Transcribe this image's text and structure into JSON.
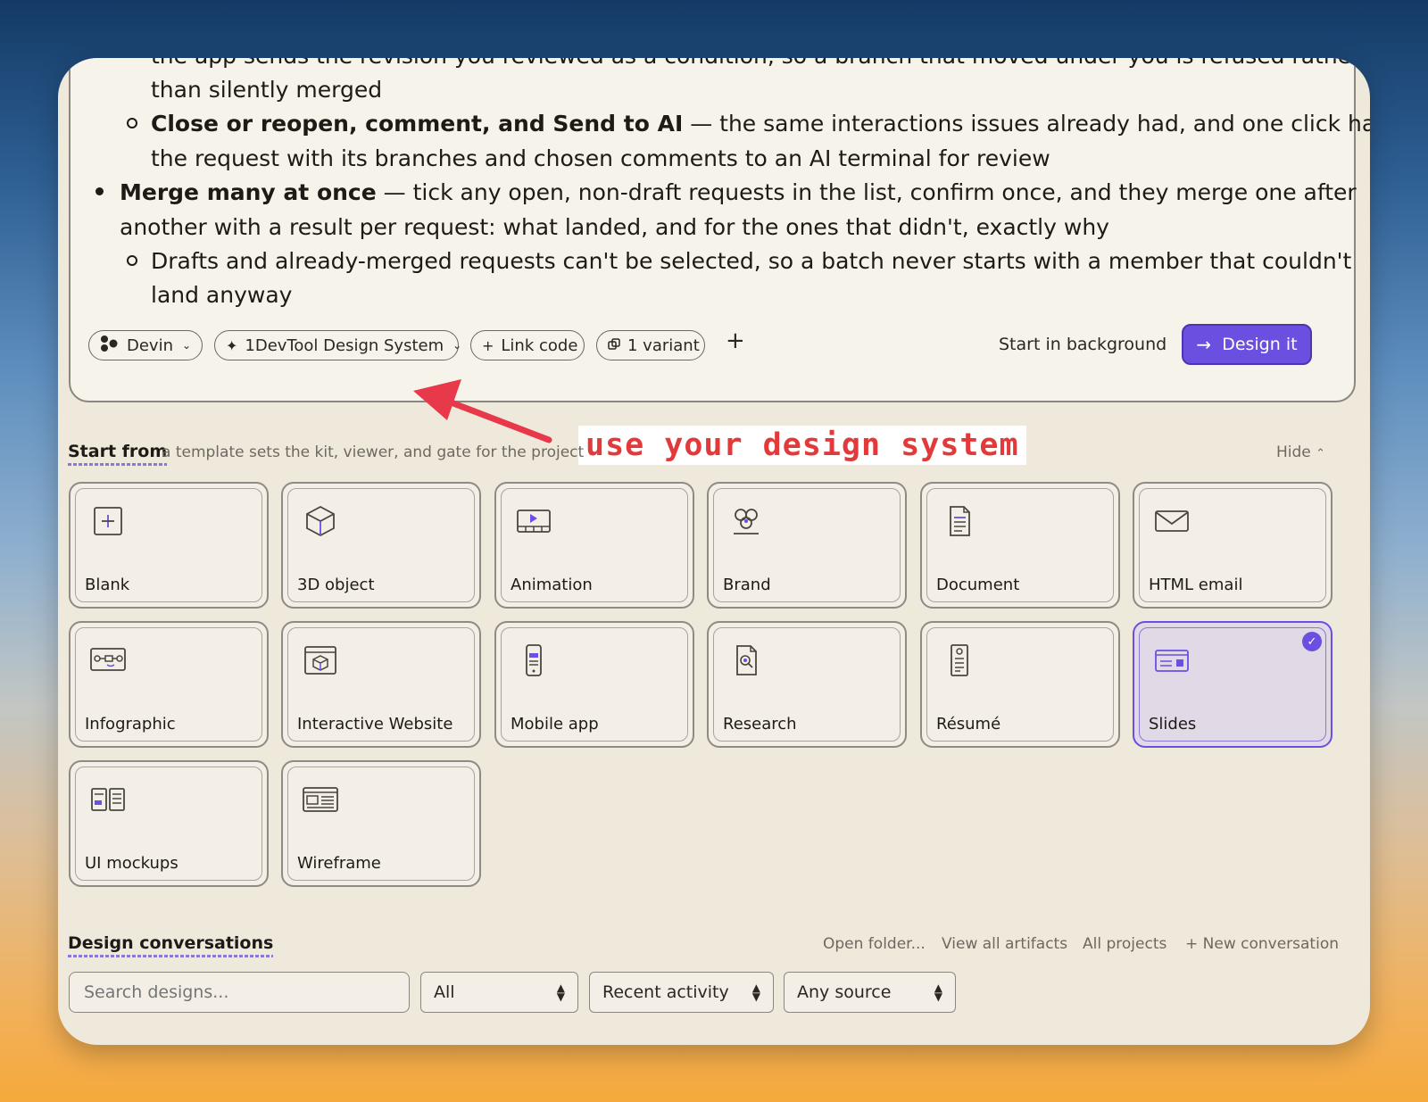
{
  "notes": {
    "line1": "the app sends the revision you reviewed as a condition, so a branch that moved under you is refused rather",
    "line2": "than silently merged",
    "line3_bold": "Close or reopen, comment, and Send to AI",
    "line3_rest": " — the same interactions issues already had, and one click hands",
    "line4": "the request with its branches and chosen comments to an AI terminal for review",
    "line5_bold": "Merge many at once",
    "line5_rest": " — tick any open, non-draft requests in the list, confirm once, and they merge one after",
    "line6": "another with a result per request: what landed, and for the ones that didn't, exactly why",
    "line7": "Drafts and already-merged requests can't be selected, so a batch never starts with a member that couldn't",
    "line8": "land anyway"
  },
  "toolbar": {
    "agent": "Devin",
    "design_system": "1DevTool Design System",
    "link_code": "Link code",
    "variant": "1 variant",
    "start_bg": "Start in background",
    "design_it": "Design it"
  },
  "annotation": {
    "label": "use your design system",
    "color": "#e23a3a"
  },
  "start_from": {
    "title": "Start from",
    "hint": "a template sets the kit, viewer, and gate for the project",
    "hide": "Hide",
    "templates": [
      {
        "label": "Blank",
        "icon": "plus-square-icon"
      },
      {
        "label": "3D object",
        "icon": "cube-icon"
      },
      {
        "label": "Animation",
        "icon": "film-play-icon"
      },
      {
        "label": "Brand",
        "icon": "brand-circles-icon"
      },
      {
        "label": "Document",
        "icon": "document-icon"
      },
      {
        "label": "HTML email",
        "icon": "envelope-icon"
      },
      {
        "label": "Infographic",
        "icon": "flow-icon"
      },
      {
        "label": "Interactive Website",
        "icon": "browser-cube-icon"
      },
      {
        "label": "Mobile app",
        "icon": "phone-icon"
      },
      {
        "label": "Research",
        "icon": "search-doc-icon"
      },
      {
        "label": "Résumé",
        "icon": "resume-icon"
      },
      {
        "label": "Slides",
        "icon": "slides-icon",
        "selected": true
      },
      {
        "label": "UI mockups",
        "icon": "mockup-icon"
      },
      {
        "label": "Wireframe",
        "icon": "wireframe-icon"
      }
    ]
  },
  "conversations": {
    "title": "Design conversations",
    "open_folder": "Open folder...",
    "view_all": "View all artifacts",
    "all_projects": "All projects",
    "new_conv": "+ New conversation",
    "search_placeholder": "Search designs...",
    "filter_all": "All",
    "sort": "Recent activity",
    "source": "Any source"
  },
  "colors": {
    "accent": "#6a4fe0",
    "card": "#f6f3ea",
    "panel": "#efe9dc"
  }
}
